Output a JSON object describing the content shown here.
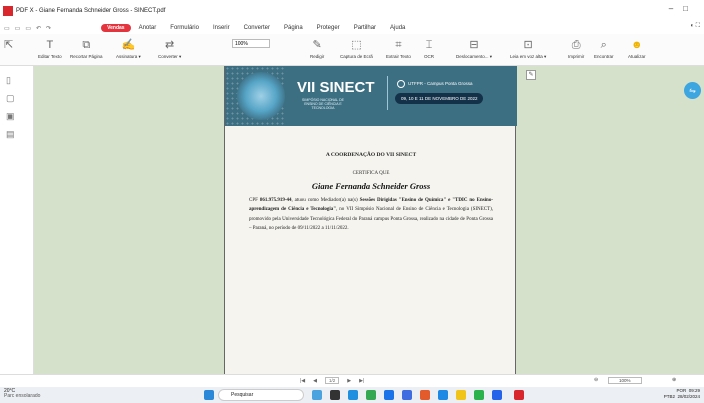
{
  "window": {
    "title": "PDF X - Giane Fernanda Schneider Gross - SINECT.pdf"
  },
  "menu": {
    "vendas": "Vendas",
    "items": [
      "Anotar",
      "Formulário",
      "Inserir",
      "Converter",
      "Página",
      "Proteger",
      "Partilhar",
      "Ajuda"
    ]
  },
  "ribbon": {
    "edit": "Editar Texto",
    "crop": "Recortar Página",
    "sign": "Assinatura ▾",
    "convert": "Converter ▾",
    "zoom": "100%",
    "draw": "Redigir",
    "capture": "Captura de Ecrã",
    "extract": "Extrair Texto",
    "ocr": "OCR",
    "scroll": "Deslocamento... ▾",
    "readaloud": "Leia em voz alta ▾",
    "print": "Imprimir",
    "find": "Encontrar",
    "update": "Atualizar"
  },
  "banner": {
    "title": "VII SINECT",
    "subtitle": "SIMPÓSIO NACIONAL DE ENSINO DE CIÊNCIA E TECNOLOGIA",
    "campus": "UTFPR - Campus Ponta Grossa",
    "dates": "09, 10 E 11 DE NOVEMBRO DE 2022"
  },
  "certificate": {
    "coordination": "A COORDENAÇÃO DO VII SINECT",
    "certifies": "CERTIFICA QUE",
    "name": "Giane Fernanda Schneider Gross",
    "b1": "CPF ",
    "cpf": "861.975.919-44",
    "b2": ", atuou como Mediador(a) na(s) ",
    "session": "Sessões Dirigidas \"Ensino de Química\" e \"TDIC no Ensino-aprendizagem de Ciência e Tecnologia\"",
    "b3": ", no VII Simpósio Nacional de Ensino de Ciência e Tecnologia (SINECT), promovido pela Universidade Tecnológica Federal do Paraná campus Ponta Grossa, realizado na cidade de Ponta Grossa – Paraná, no período de 09/11/2022 a 11/11/2022."
  },
  "status": {
    "page": "1/2",
    "zoom": "100%"
  },
  "taskbar": {
    "temp": "20°C",
    "weather": "Parc ensolarado",
    "search": "Pesquisar",
    "lang": "POR",
    "layout": "PTB2",
    "time": "09:29",
    "date": "28/02/2024"
  },
  "colors": {
    "canvas": "#d5e1cb",
    "banner": "#3d6f83",
    "accent": "#e4343e"
  }
}
